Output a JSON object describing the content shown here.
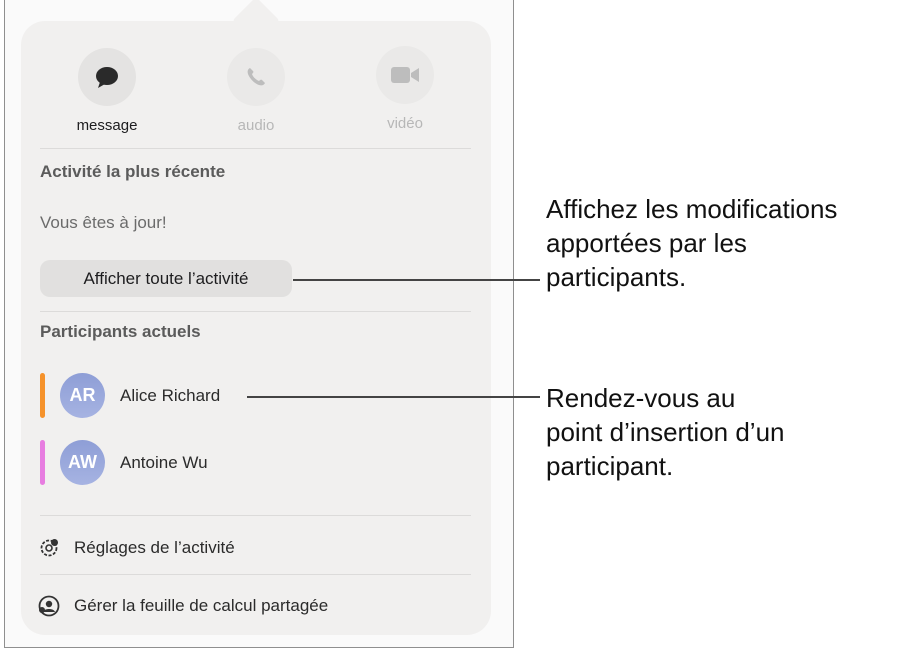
{
  "actions": [
    {
      "label": "message",
      "icon": "message-bubble-icon",
      "enabled": true
    },
    {
      "label": "audio",
      "icon": "phone-icon",
      "enabled": false
    },
    {
      "label": "vidéo",
      "icon": "video-camera-icon",
      "enabled": false
    }
  ],
  "activity": {
    "title": "Activité la plus récente",
    "status": "Vous êtes à jour!",
    "show_all_label": "Afficher toute l’activité"
  },
  "participants": {
    "title": "Participants actuels",
    "list": [
      {
        "initials": "AR",
        "name": "Alice Richard",
        "color": "#f5922b"
      },
      {
        "initials": "AW",
        "name": "Antoine Wu",
        "color": "#e77de0"
      }
    ]
  },
  "menu": {
    "settings_label": "Réglages de l’activité",
    "manage_label": "Gérer la feuille de calcul partagée"
  },
  "callouts": {
    "activity": [
      "Affichez les modifications",
      "apportées par les",
      "participants."
    ],
    "participant": [
      "Rendez-vous au",
      "point d’insertion d’un",
      "participant."
    ]
  }
}
